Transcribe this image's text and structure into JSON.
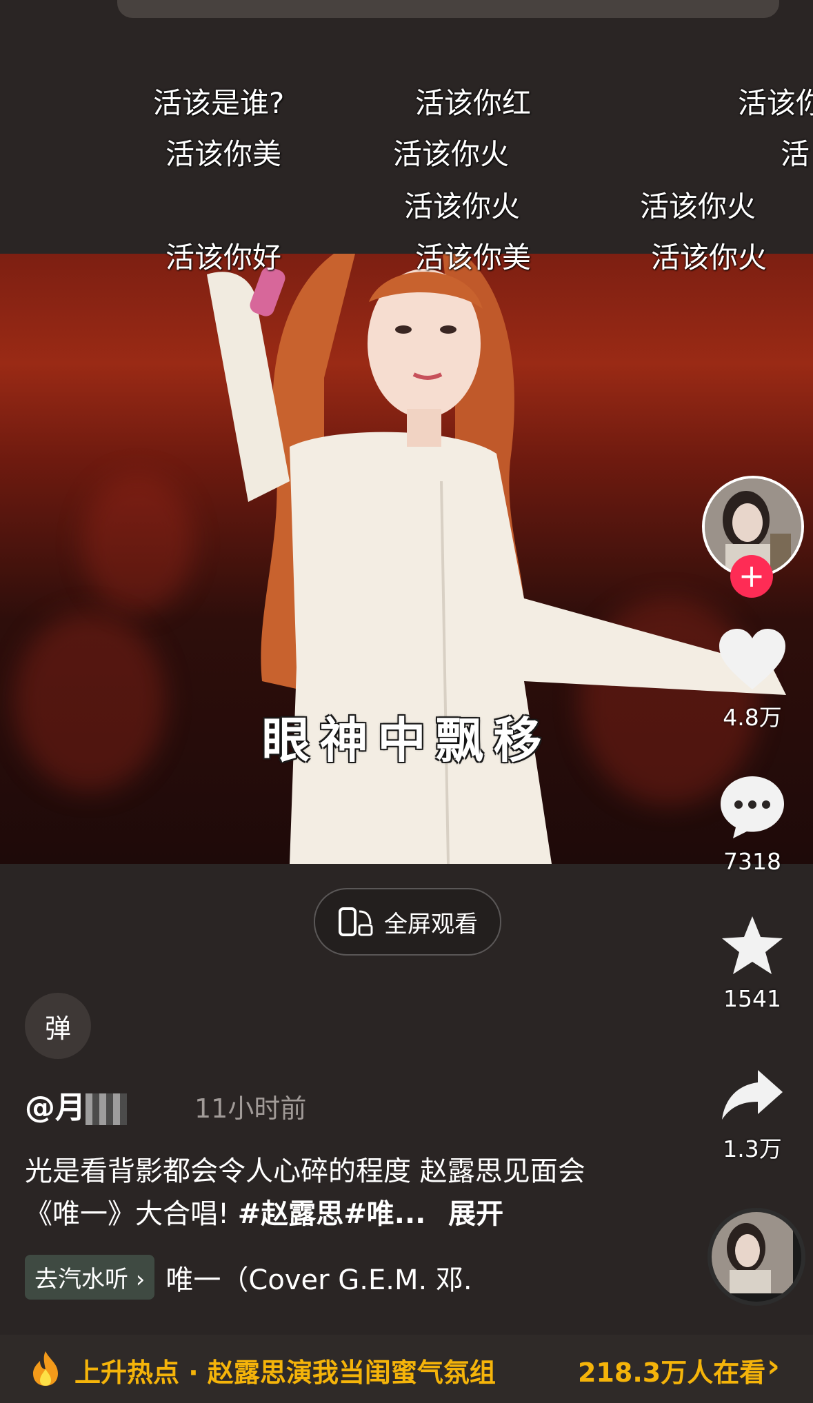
{
  "danmaku": [
    "活该是谁?",
    "活该你红",
    "活该你",
    "活该你美",
    "活该你火",
    "活",
    "活该你火",
    "活该你火",
    "活该你好",
    "活该你美",
    "活该你火"
  ],
  "video": {
    "subtitle": "眼神中飘移"
  },
  "rail": {
    "like_count": "4.8万",
    "comment_count": "7318",
    "favorite_count": "1541",
    "share_count": "1.3万",
    "follow_symbol": "+"
  },
  "fullscreen": {
    "label": "全屏观看"
  },
  "danmu_toggle": {
    "label": "弹"
  },
  "post": {
    "author_prefix": "@月",
    "time": "11小时前",
    "desc": "光是看背影都会令人心碎的程度 赵露思见面会《唯一》大合唱!",
    "tags": "#赵露思#唯...",
    "expand": "展开"
  },
  "music": {
    "chip": "去汽水听 ›",
    "title": "唯一（Cover G.E.M. 邓."
  },
  "hot": {
    "text": "上升热点 · 赵露思演我当闺蜜气氛组",
    "watching": "218.3万人在看",
    "arrow": "›"
  },
  "colors": {
    "accent": "#fe2c55",
    "hot": "#f5b40a"
  }
}
